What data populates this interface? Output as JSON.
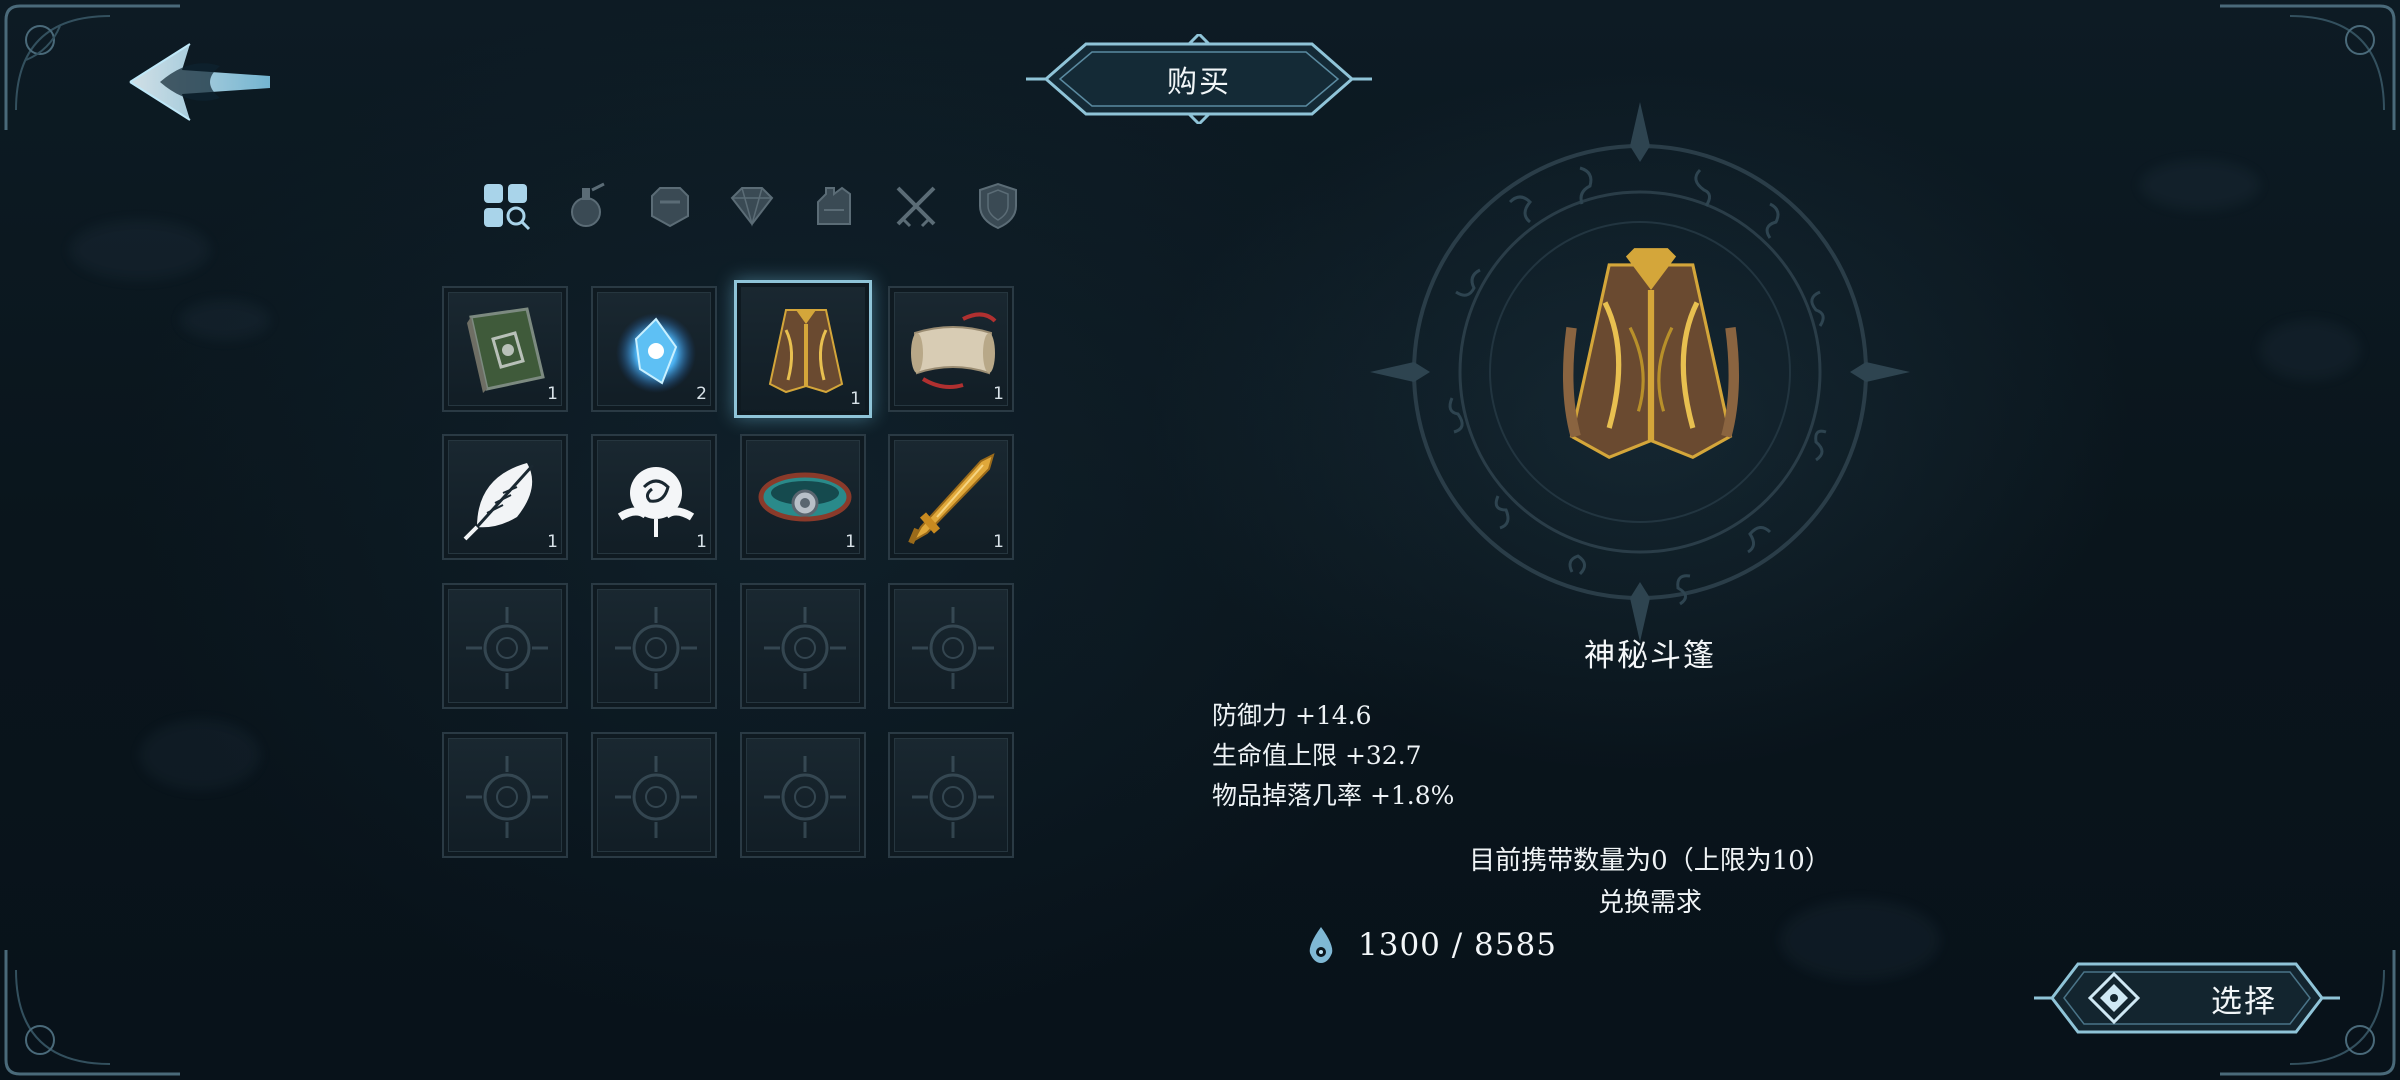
{
  "header": {
    "title": "购买"
  },
  "tabs": [
    {
      "icon": "all-items-icon"
    },
    {
      "icon": "potion-icon"
    },
    {
      "icon": "helmet-icon"
    },
    {
      "icon": "gem-icon"
    },
    {
      "icon": "gauntlet-icon"
    },
    {
      "icon": "crossed-swords-icon"
    },
    {
      "icon": "shield-icon"
    }
  ],
  "grid": {
    "items": [
      {
        "icon": "green-tome-icon",
        "count": "1"
      },
      {
        "icon": "blue-crystal-icon",
        "count": "2"
      },
      {
        "icon": "cloak-icon",
        "count": "1",
        "selected": true
      },
      {
        "icon": "scroll-icon",
        "count": "1"
      },
      {
        "icon": "feather-icon",
        "count": "1"
      },
      {
        "icon": "rose-icon",
        "count": "1"
      },
      {
        "icon": "bracelet-icon",
        "count": "1"
      },
      {
        "icon": "golden-sword-icon",
        "count": "1"
      }
    ],
    "empty_slots": 8
  },
  "detail": {
    "name": "神秘斗篷",
    "stats": [
      "防御力 +14.6",
      "生命值上限 +32.7",
      "物品掉落几率 +1.8%"
    ],
    "carry_text": "目前携带数量为0（上限为10）",
    "requirement_label": "兑换需求",
    "cost": "1300 / 8585",
    "currency_icon": "soul-drop-icon"
  },
  "actions": {
    "select_label": "选择"
  },
  "colors": {
    "accent": "#8fc4d8",
    "gold": "#d4a63a",
    "background": "#0a151c"
  }
}
